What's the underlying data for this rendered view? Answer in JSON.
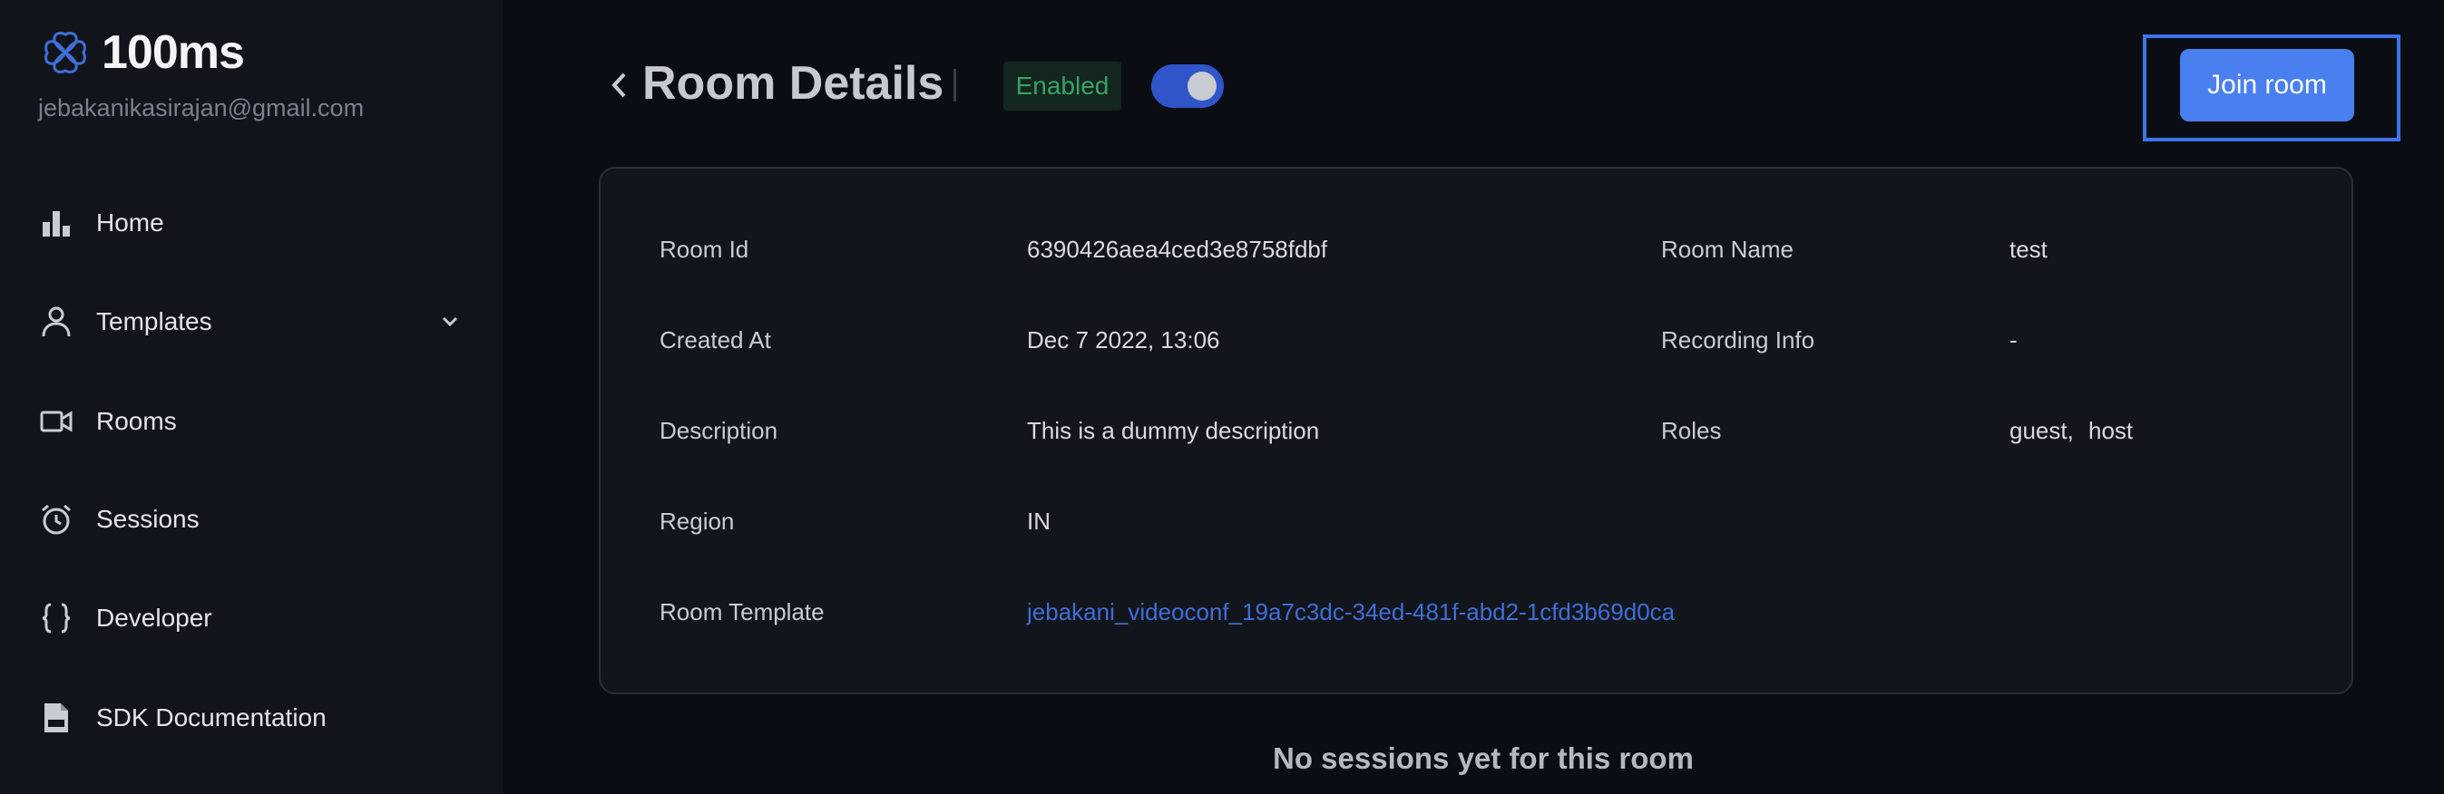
{
  "sidebar": {
    "brand": "100ms",
    "email": "jebakanikasirajan@gmail.com",
    "items": [
      {
        "label": "Home",
        "icon": "bar-chart-icon"
      },
      {
        "label": "Templates",
        "icon": "person-icon"
      },
      {
        "label": "Rooms",
        "icon": "video-camera-icon"
      },
      {
        "label": "Sessions",
        "icon": "alarm-clock-icon"
      },
      {
        "label": "Developer",
        "icon": "curly-braces-icon"
      },
      {
        "label": "SDK Documentation",
        "icon": "document-icon"
      }
    ]
  },
  "header": {
    "title": "Room Details",
    "status": "Enabled",
    "toggle_on": true,
    "join_label": "Join room"
  },
  "details": {
    "room_id_label": "Room Id",
    "room_id": "6390426aea4ced3e8758fdbf",
    "room_name_label": "Room Name",
    "room_name": "test",
    "created_at_label": "Created At",
    "created_at": "Dec 7 2022, 13:06",
    "recording_info_label": "Recording Info",
    "recording_info": "-",
    "description_label": "Description",
    "description": "This is a dummy description",
    "roles_label": "Roles",
    "roles": [
      "guest,",
      "host"
    ],
    "region_label": "Region",
    "region": "IN",
    "room_template_label": "Room Template",
    "room_template": "jebakani_videoconf_19a7c3dc-34ed-481f-abd2-1cfd3b69d0ca"
  },
  "sessions": {
    "empty_message": "No sessions yet for this room"
  },
  "colors": {
    "accent": "#4a7ff0",
    "enabled_text": "#37a364",
    "link": "#3e6fd8"
  }
}
